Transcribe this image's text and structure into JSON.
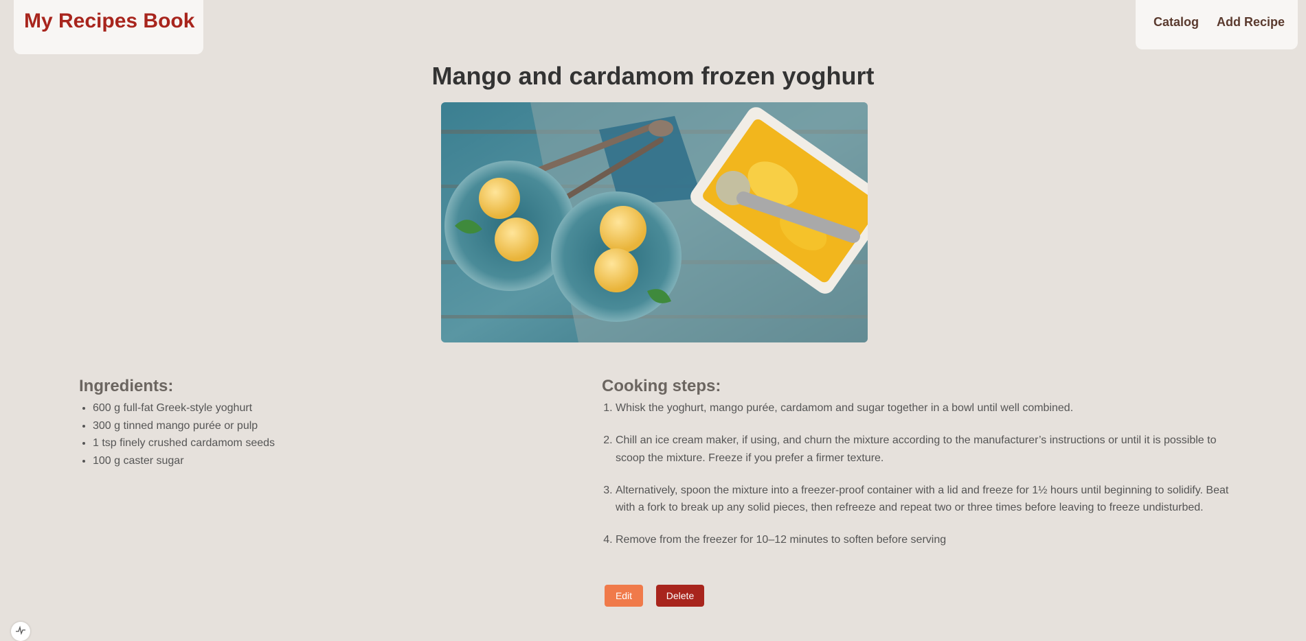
{
  "header": {
    "logo": "My Recipes Book",
    "nav": {
      "catalog": "Catalog",
      "add_recipe": "Add Recipe"
    }
  },
  "recipe": {
    "title": "Mango and cardamom frozen yoghurt",
    "ingredients_heading": "Ingredients:",
    "ingredients": [
      "600 g full-fat Greek-style yoghurt",
      "300 g tinned mango purée or pulp",
      "1 tsp finely crushed cardamom seeds",
      "100 g caster sugar"
    ],
    "steps_heading": "Cooking steps:",
    "steps": [
      "Whisk the yoghurt, mango purée, cardamom and sugar together in a bowl until well combined.",
      "Chill an ice cream maker, if using, and churn the mixture according to the manufacturer’s instructions or until it is possible to scoop the mixture. Freeze if you prefer a firmer texture.",
      "Alternatively, spoon the mixture into a freezer-proof container with a lid and freeze for 1½ hours until beginning to solidify. Beat with a fork to break up any solid pieces, then refreeze and repeat two or three times before leaving to freeze undisturbed.",
      "Remove from the freezer for 10–12 minutes to soften before serving"
    ]
  },
  "actions": {
    "edit_label": "Edit",
    "delete_label": "Delete"
  },
  "colors": {
    "brand": "#a8251d",
    "edit": "#f07a4a",
    "delete": "#a8251d",
    "background": "#e6e1dc"
  },
  "icons": {
    "corner": "activity-icon"
  }
}
